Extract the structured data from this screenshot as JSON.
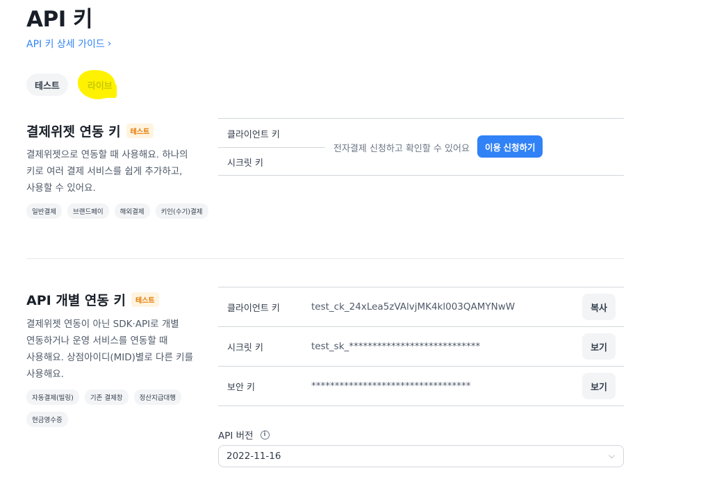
{
  "header": {
    "title": "API 키",
    "guide_link": "API 키 상세 가이드",
    "guide_chevron": "›"
  },
  "env_tabs": [
    {
      "label": "테스트",
      "active": true
    },
    {
      "label": "라이브",
      "active": false
    }
  ],
  "widget_section": {
    "title": "결제위젯 연동 키",
    "badge": "테스트",
    "desc_lines": [
      "결제위젯으로 연동할 때 사용해요. 하나의",
      "키로 여러 결제 서비스를 쉽게 추가하고,",
      "사용할 수 있어요."
    ],
    "tags": [
      "일반결제",
      "브랜드페이",
      "해외결제",
      "키인(수기)결제"
    ],
    "rows": [
      "클라이언트 키",
      "시크릿 키"
    ],
    "message": "전자결제 신청하고 확인할 수 있어요",
    "apply_button": "이용 신청하기"
  },
  "api_section": {
    "title": "API 개별 연동 키",
    "badge": "테스트",
    "desc_lines": [
      "결제위젯 연동이 아닌 SDK·API로 개별",
      "연동하거나 운영 서비스를 연동할 때",
      "사용해요. 상점아이디(MID)별로 다른 키를",
      "사용해요."
    ],
    "tags": [
      "자동결제(빌링)",
      "기존 결제창",
      "정산지급대행",
      "현금영수증"
    ],
    "rows": [
      {
        "label": "클라이언트 키",
        "value": "test_ck_24xLea5zVAlvjMK4kl003QAMYNwW",
        "button": "복사"
      },
      {
        "label": "시크릿 키",
        "value": "test_sk_****************************",
        "button": "보기"
      },
      {
        "label": "보안 키",
        "value": "**********************************",
        "button": "보기"
      }
    ]
  },
  "api_version": {
    "label": "API 버전",
    "info_icon": "i",
    "selected": "2022-11-16",
    "chevron": "⌵"
  },
  "colors": {
    "accent": "#3182f6",
    "badge_text": "#e67700",
    "badge_bg": "#fff4e0",
    "highlight": "#fff200"
  }
}
